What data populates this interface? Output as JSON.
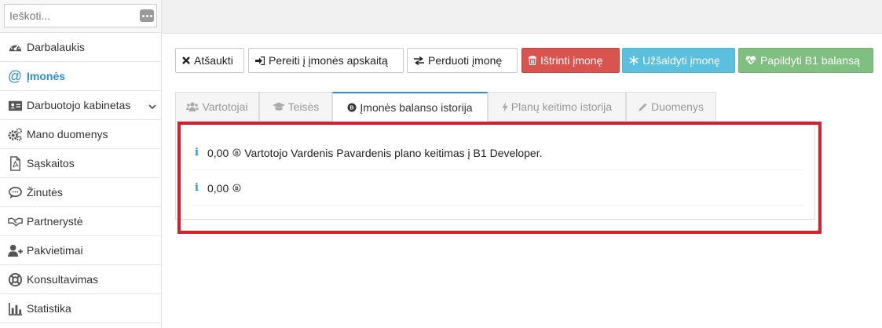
{
  "search": {
    "placeholder": "Ieškoti...",
    "more_icon": "ellipsis-icon"
  },
  "sidebar": {
    "items": [
      {
        "label": "Darbalaukis",
        "icon": "dashboard-icon"
      },
      {
        "label": "Įmonės",
        "icon": "at-icon",
        "active": true
      },
      {
        "label": "Darbuotojo kabinetas",
        "icon": "id-card-icon",
        "has_submenu": true
      },
      {
        "label": "Mano duomenys",
        "icon": "gears-icon"
      },
      {
        "label": "Sąskaitos",
        "icon": "pdf-file-icon"
      },
      {
        "label": "Žinutės",
        "icon": "chat-icon"
      },
      {
        "label": "Partnerystė",
        "icon": "handshake-icon"
      },
      {
        "label": "Pakvietimai",
        "icon": "user-plus-icon"
      },
      {
        "label": "Konsultavimas",
        "icon": "life-ring-icon"
      },
      {
        "label": "Statistika",
        "icon": "bar-chart-icon"
      }
    ]
  },
  "toolbar": {
    "cancel": "Atšaukti",
    "goto_accounting": "Pereiti į įmonės apskaitą",
    "transfer": "Perduoti įmonę",
    "delete": "Ištrinti įmonę",
    "freeze": "Užšaldyti įmonę",
    "topup": "Papildyti B1 balansą"
  },
  "tabs": [
    {
      "label": "Vartotojai",
      "icon": "users-icon"
    },
    {
      "label": "Teisės",
      "icon": "graduation-cap-icon"
    },
    {
      "label": "Įmonės balanso istorija",
      "icon": "b1-coin-icon",
      "active": true
    },
    {
      "label": "Planų keitimo istorija",
      "icon": "bolt-icon"
    },
    {
      "label": "Duomenys",
      "icon": "pencil-icon"
    }
  ],
  "history": [
    {
      "amount": "0,00",
      "description": "Vartotojo Vardenis Pavardenis plano keitimas į B1 Developer."
    },
    {
      "amount": "0,00",
      "description": ""
    }
  ],
  "colors": {
    "accent": "#2a8fd8",
    "danger": "#d9534f",
    "info": "#5bc0de",
    "success": "#7fbf7f",
    "highlight": "#dc1e2a"
  }
}
